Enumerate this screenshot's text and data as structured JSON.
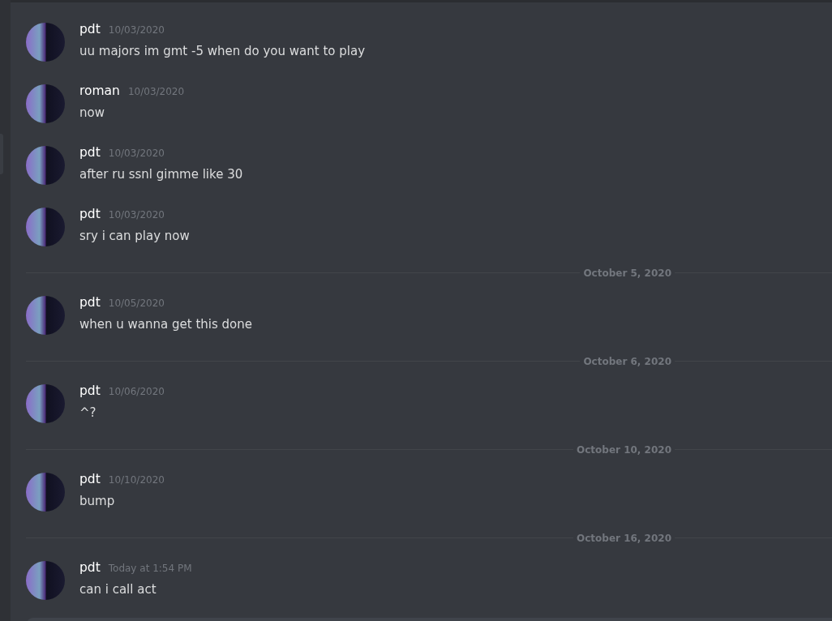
{
  "messages": [
    {
      "kind": "message",
      "author": "pdt",
      "time": "10/03/2020",
      "text": "uu majors im gmt -5 when do you want to play"
    },
    {
      "kind": "message",
      "author": "roman",
      "time": "10/03/2020",
      "text": "now"
    },
    {
      "kind": "message",
      "author": "pdt",
      "time": "10/03/2020",
      "text": "after ru ssnl gimme like 30"
    },
    {
      "kind": "message",
      "author": "pdt",
      "time": "10/03/2020",
      "text": "sry i can play now"
    },
    {
      "kind": "divider",
      "label": "October 5, 2020"
    },
    {
      "kind": "message",
      "author": "pdt",
      "time": "10/05/2020",
      "text": "when u wanna get this done"
    },
    {
      "kind": "divider",
      "label": "October 6, 2020"
    },
    {
      "kind": "message",
      "author": "pdt",
      "time": "10/06/2020",
      "text": "^?"
    },
    {
      "kind": "divider",
      "label": "October 10, 2020"
    },
    {
      "kind": "message",
      "author": "pdt",
      "time": "10/10/2020",
      "text": "bump"
    },
    {
      "kind": "divider",
      "label": "October 16, 2020"
    },
    {
      "kind": "message",
      "author": "pdt",
      "time": "Today at 1:54 PM",
      "text": "can i call act"
    }
  ]
}
